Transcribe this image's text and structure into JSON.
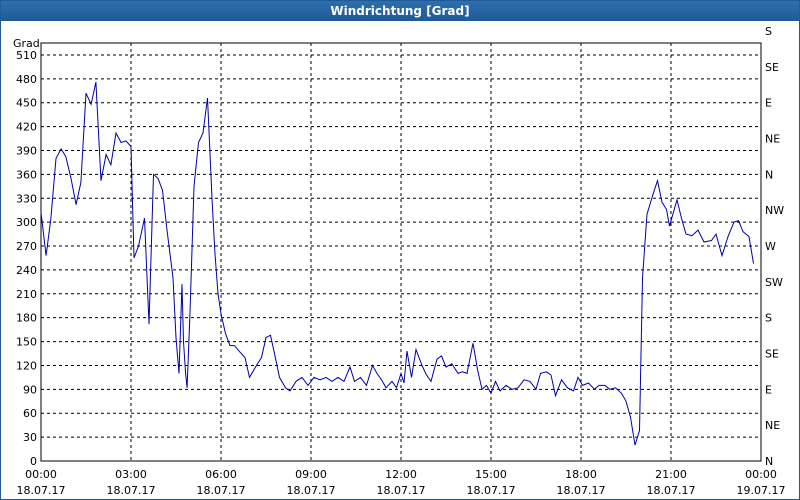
{
  "window": {
    "title": "Windrichtung [Grad]"
  },
  "colors": {
    "line": "#0000aa",
    "grid": "#000000",
    "titlebar": "#1e5a96"
  },
  "chart_data": {
    "type": "line",
    "title": "Windrichtung [Grad]",
    "ylabel": "Grad",
    "ylim": [
      0,
      525
    ],
    "yticks": [
      0,
      30,
      60,
      90,
      120,
      150,
      180,
      210,
      240,
      270,
      300,
      330,
      360,
      390,
      420,
      450,
      480,
      510
    ],
    "right_ticks": [
      {
        "value": 0,
        "label": "N"
      },
      {
        "value": 45,
        "label": "NE"
      },
      {
        "value": 90,
        "label": "E"
      },
      {
        "value": 135,
        "label": "SE"
      },
      {
        "value": 180,
        "label": "S"
      },
      {
        "value": 225,
        "label": "SW"
      },
      {
        "value": 270,
        "label": "W"
      },
      {
        "value": 315,
        "label": "NW"
      },
      {
        "value": 360,
        "label": "N"
      },
      {
        "value": 405,
        "label": "NE"
      },
      {
        "value": 450,
        "label": "E"
      },
      {
        "value": 495,
        "label": "SE"
      },
      {
        "value": 540,
        "label": "S"
      }
    ],
    "xlim": [
      0,
      24
    ],
    "xticks": [
      {
        "hour": 0,
        "time": "00:00",
        "date": "18.07.17"
      },
      {
        "hour": 3,
        "time": "03:00",
        "date": "18.07.17"
      },
      {
        "hour": 6,
        "time": "06:00",
        "date": "18.07.17"
      },
      {
        "hour": 9,
        "time": "09:00",
        "date": "18.07.17"
      },
      {
        "hour": 12,
        "time": "12:00",
        "date": "18.07.17"
      },
      {
        "hour": 15,
        "time": "15:00",
        "date": "18.07.17"
      },
      {
        "hour": 18,
        "time": "18:00",
        "date": "18.07.17"
      },
      {
        "hour": 21,
        "time": "21:00",
        "date": "18.07.17"
      },
      {
        "hour": 24,
        "time": "00:00",
        "date": "19.07.17"
      }
    ],
    "grid": true,
    "series": [
      {
        "points": [
          [
            0.0,
            312
          ],
          [
            0.17,
            258
          ],
          [
            0.33,
            305
          ],
          [
            0.5,
            380
          ],
          [
            0.67,
            392
          ],
          [
            0.83,
            382
          ],
          [
            1.0,
            355
          ],
          [
            1.17,
            322
          ],
          [
            1.33,
            350
          ],
          [
            1.5,
            462
          ],
          [
            1.67,
            448
          ],
          [
            1.83,
            476
          ],
          [
            2.0,
            352
          ],
          [
            2.17,
            385
          ],
          [
            2.33,
            372
          ],
          [
            2.5,
            412
          ],
          [
            2.67,
            400
          ],
          [
            2.83,
            402
          ],
          [
            3.0,
            395
          ],
          [
            3.1,
            255
          ],
          [
            3.25,
            270
          ],
          [
            3.45,
            305
          ],
          [
            3.6,
            172
          ],
          [
            3.75,
            360
          ],
          [
            3.9,
            355
          ],
          [
            4.05,
            340
          ],
          [
            4.2,
            290
          ],
          [
            4.4,
            230
          ],
          [
            4.5,
            155
          ],
          [
            4.6,
            110
          ],
          [
            4.7,
            222
          ],
          [
            4.75,
            150
          ],
          [
            4.82,
            110
          ],
          [
            4.87,
            92
          ],
          [
            4.97,
            190
          ],
          [
            5.1,
            345
          ],
          [
            5.25,
            400
          ],
          [
            5.4,
            412
          ],
          [
            5.55,
            456
          ],
          [
            5.7,
            330
          ],
          [
            5.8,
            260
          ],
          [
            5.9,
            210
          ],
          [
            6.0,
            185
          ],
          [
            6.15,
            160
          ],
          [
            6.3,
            145
          ],
          [
            6.45,
            145
          ],
          [
            6.6,
            138
          ],
          [
            6.8,
            130
          ],
          [
            6.95,
            105
          ],
          [
            7.15,
            118
          ],
          [
            7.35,
            130
          ],
          [
            7.5,
            155
          ],
          [
            7.65,
            158
          ],
          [
            7.8,
            132
          ],
          [
            7.95,
            105
          ],
          [
            8.15,
            92
          ],
          [
            8.3,
            88
          ],
          [
            8.5,
            100
          ],
          [
            8.7,
            105
          ],
          [
            8.9,
            95
          ],
          [
            9.1,
            105
          ],
          [
            9.3,
            102
          ],
          [
            9.5,
            105
          ],
          [
            9.7,
            100
          ],
          [
            9.9,
            105
          ],
          [
            10.1,
            100
          ],
          [
            10.3,
            118
          ],
          [
            10.45,
            100
          ],
          [
            10.65,
            105
          ],
          [
            10.85,
            95
          ],
          [
            11.05,
            120
          ],
          [
            11.2,
            110
          ],
          [
            11.35,
            102
          ],
          [
            11.5,
            92
          ],
          [
            11.7,
            100
          ],
          [
            11.85,
            92
          ],
          [
            12.0,
            110
          ],
          [
            12.1,
            98
          ],
          [
            12.2,
            138
          ],
          [
            12.35,
            105
          ],
          [
            12.5,
            140
          ],
          [
            12.7,
            120
          ],
          [
            12.85,
            108
          ],
          [
            13.0,
            100
          ],
          [
            13.2,
            128
          ],
          [
            13.35,
            132
          ],
          [
            13.5,
            118
          ],
          [
            13.7,
            122
          ],
          [
            13.9,
            110
          ],
          [
            14.05,
            112
          ],
          [
            14.2,
            110
          ],
          [
            14.4,
            148
          ],
          [
            14.55,
            115
          ],
          [
            14.7,
            90
          ],
          [
            14.85,
            95
          ],
          [
            15.0,
            85
          ],
          [
            15.15,
            100
          ],
          [
            15.3,
            88
          ],
          [
            15.5,
            95
          ],
          [
            15.7,
            90
          ],
          [
            15.9,
            92
          ],
          [
            16.1,
            102
          ],
          [
            16.3,
            100
          ],
          [
            16.5,
            90
          ],
          [
            16.65,
            110
          ],
          [
            16.85,
            112
          ],
          [
            17.0,
            108
          ],
          [
            17.15,
            82
          ],
          [
            17.35,
            102
          ],
          [
            17.55,
            92
          ],
          [
            17.75,
            88
          ],
          [
            17.9,
            105
          ],
          [
            18.05,
            95
          ],
          [
            18.25,
            98
          ],
          [
            18.45,
            90
          ],
          [
            18.6,
            95
          ],
          [
            18.8,
            95
          ],
          [
            18.95,
            90
          ],
          [
            19.15,
            92
          ],
          [
            19.35,
            85
          ],
          [
            19.5,
            75
          ],
          [
            19.65,
            55
          ],
          [
            19.8,
            20
          ],
          [
            19.95,
            38
          ],
          [
            20.05,
            230
          ],
          [
            20.2,
            310
          ],
          [
            20.4,
            335
          ],
          [
            20.55,
            352
          ],
          [
            20.7,
            325
          ],
          [
            20.85,
            316
          ],
          [
            20.95,
            295
          ],
          [
            21.1,
            315
          ],
          [
            21.2,
            328
          ],
          [
            21.35,
            305
          ],
          [
            21.5,
            285
          ],
          [
            21.7,
            283
          ],
          [
            21.9,
            290
          ],
          [
            22.1,
            275
          ],
          [
            22.35,
            277
          ],
          [
            22.5,
            285
          ],
          [
            22.7,
            258
          ],
          [
            22.9,
            282
          ],
          [
            23.1,
            300
          ],
          [
            23.25,
            302
          ],
          [
            23.4,
            288
          ],
          [
            23.6,
            282
          ],
          [
            23.75,
            248
          ]
        ]
      }
    ]
  }
}
